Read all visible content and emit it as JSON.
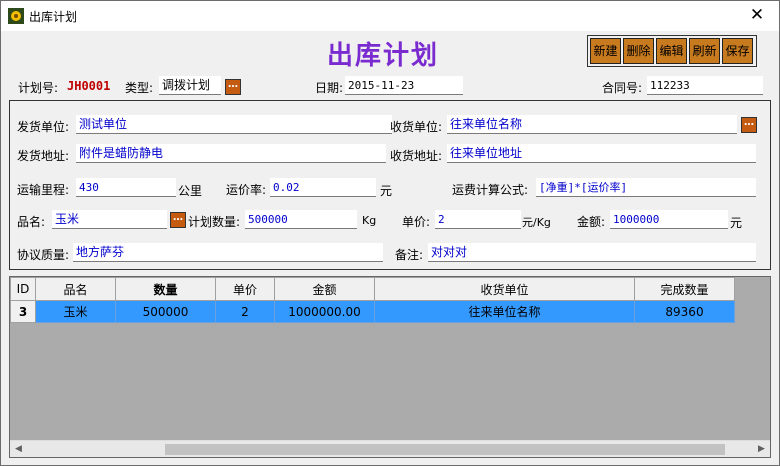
{
  "window": {
    "title": "出库计划"
  },
  "page_title": "出库计划",
  "toolbar": {
    "new": "新建",
    "delete": "删除",
    "edit": "编辑",
    "refresh": "刷新",
    "save": "保存"
  },
  "header": {
    "plan_no_label": "计划号:",
    "plan_no_value": "JH0001",
    "type_label": "类型:",
    "type_value": "调拨计划",
    "date_label": "日期:",
    "date_value": "2015-11-23",
    "contract_label": "合同号:",
    "contract_value": "112233"
  },
  "form": {
    "ship_unit_label": "发货单位:",
    "ship_unit_value": "测试单位",
    "recv_unit_label": "收货单位:",
    "recv_unit_value": "往来单位名称",
    "ship_addr_label": "发货地址:",
    "ship_addr_value": "附件是蜡防静电",
    "recv_addr_label": "收货地址:",
    "recv_addr_value": "往来单位地址",
    "distance_label": "运输里程:",
    "distance_value": "430",
    "distance_unit": "公里",
    "rate_label": "运价率:",
    "rate_value": "0.02",
    "rate_unit": "元",
    "formula_label": "运费计算公式:",
    "formula_value": "[净重]*[运价率]",
    "product_label": "品名:",
    "product_value": "玉米",
    "qty_label": "计划数量:",
    "qty_value": "500000",
    "qty_unit": "Kg",
    "price_label": "单价:",
    "price_value": "2",
    "price_unit": "元/Kg",
    "amount_label": "金额:",
    "amount_value": "1000000",
    "amount_unit": "元",
    "quality_label": "协议质量:",
    "quality_value": "地方萨芬",
    "remark_label": "备注:",
    "remark_value": "对对对"
  },
  "grid": {
    "columns": [
      "ID",
      "品名",
      "数量",
      "单价",
      "金额",
      "收货单位",
      "完成数量"
    ],
    "rows": [
      [
        "3",
        "玉米",
        "500000",
        "2",
        "1000000.00",
        "往来单位名称",
        "89360"
      ]
    ]
  },
  "colors": {
    "title": "#7a2bd0",
    "button": "#c87a1e",
    "selection": "#3399ff",
    "value_text": "#0000cc",
    "plan_no": "#c00000"
  }
}
